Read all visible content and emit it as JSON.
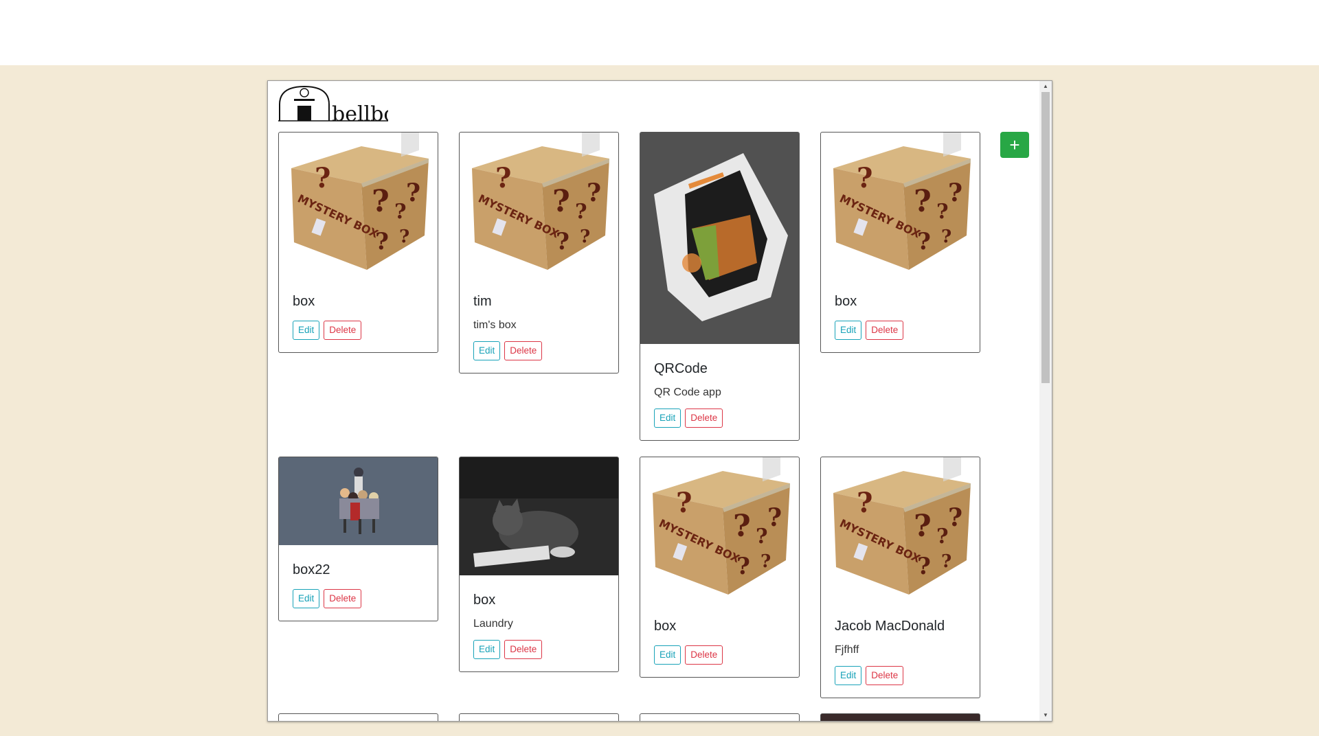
{
  "app": {
    "logo_text": "bellbois"
  },
  "toolbar": {
    "add_label": "+"
  },
  "cards": [
    {
      "title": "box",
      "description": "",
      "image": "mystery-box",
      "edit_label": "Edit",
      "delete_label": "Delete"
    },
    {
      "title": "tim",
      "description": "tim's box",
      "image": "mystery-box",
      "edit_label": "Edit",
      "delete_label": "Delete"
    },
    {
      "title": "QRCode",
      "description": "QR Code app",
      "image": "open-box-photo",
      "edit_label": "Edit",
      "delete_label": "Delete"
    },
    {
      "title": "box",
      "description": "",
      "image": "mystery-box",
      "edit_label": "Edit",
      "delete_label": "Delete"
    },
    {
      "title": "box22",
      "description": "",
      "image": "anime-group",
      "edit_label": "Edit",
      "delete_label": "Delete"
    },
    {
      "title": "box",
      "description": "Laundry",
      "image": "cat-photo",
      "edit_label": "Edit",
      "delete_label": "Delete"
    },
    {
      "title": "box",
      "description": "",
      "image": "mystery-box",
      "edit_label": "Edit",
      "delete_label": "Delete"
    },
    {
      "title": "Jacob MacDonald",
      "description": "Fjfhff",
      "image": "mystery-box",
      "edit_label": "Edit",
      "delete_label": "Delete"
    }
  ],
  "colors": {
    "background": "#f3ead6",
    "add_button": "#28a745",
    "edit": "#17a2b8",
    "delete": "#dc3545"
  }
}
